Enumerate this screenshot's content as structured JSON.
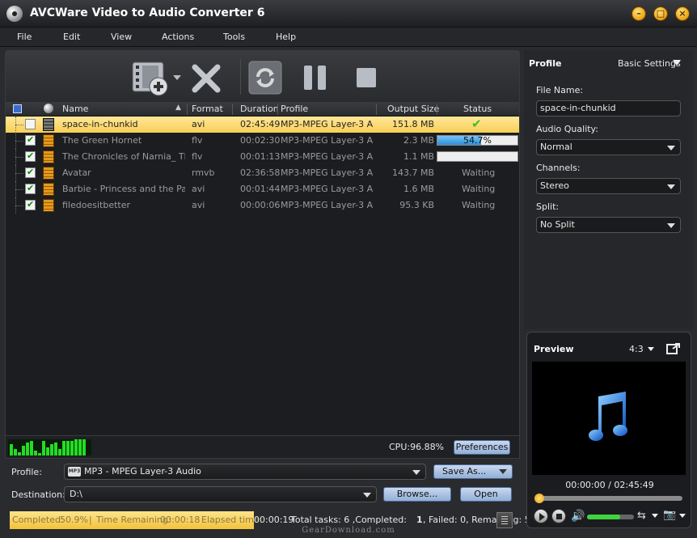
{
  "window": {
    "title": "AVCWare Video to Audio Converter 6",
    "minimize": "–",
    "maximize": "□",
    "close": "×"
  },
  "menu": [
    "File",
    "Edit",
    "View",
    "Actions",
    "Tools",
    "Help"
  ],
  "table": {
    "columns": [
      "Name",
      "Format",
      "Duration",
      "Profile",
      "Output Size",
      "Status"
    ],
    "rows": [
      {
        "name": "space-in-chunkid",
        "format": "avi",
        "duration": "02:45:49",
        "profile": "MP3-MPEG Layer-3 A...",
        "size": "151.8 MB",
        "status": "",
        "checked": false,
        "selected": true
      },
      {
        "name": "The Green Hornet",
        "format": "flv",
        "duration": "00:02:30",
        "profile": "MP3-MPEG Layer-3 A...",
        "size": "2.3 MB",
        "status": "54.7%",
        "progress": 54.7,
        "checked": true
      },
      {
        "name": "The Chronicles of Narnia_ The...",
        "format": "flv",
        "duration": "00:01:13",
        "profile": "MP3-MPEG Layer-3 A...",
        "size": "1.1 MB",
        "status": "",
        "progress": 0,
        "checked": true
      },
      {
        "name": "Avatar",
        "format": "rmvb",
        "duration": "02:36:58",
        "profile": "MP3-MPEG Layer-3 A...",
        "size": "143.7 MB",
        "status": "Waiting",
        "checked": true
      },
      {
        "name": "Barbie - Princess and the Pau...",
        "format": "avi",
        "duration": "00:01:44",
        "profile": "MP3-MPEG Layer-3 A...",
        "size": "1.6 MB",
        "status": "Waiting",
        "checked": true
      },
      {
        "name": "filedoesitbetter",
        "format": "avi",
        "duration": "00:00:06",
        "profile": "MP3-MPEG Layer-3 A...",
        "size": "95.3 KB",
        "status": "Waiting",
        "checked": true
      }
    ]
  },
  "cpu": {
    "label": "CPU:96.88%"
  },
  "buttons": {
    "preferences": "Preferences",
    "save_as": "Save As...",
    "browse": "Browse...",
    "open": "Open"
  },
  "profile_bar": {
    "label": "Profile:",
    "value": "MP3 - MPEG Layer-3 Audio",
    "icon_text": "MP3"
  },
  "destination": {
    "label": "Destination:",
    "value": "D:\\"
  },
  "footer": {
    "completed_label": "Completed:",
    "completed_value": "50.9%",
    "sep": "|",
    "remaining_label": "Time Remaining:",
    "remaining_value": "00:00:18",
    "elapsed_label": "Elapsed time:",
    "elapsed_value": "00:00:19",
    "total": "Total tasks: 6 ,Completed: ",
    "completed_count": "1",
    "rest": ", Failed: 0, Remaining: 5"
  },
  "right_panel": {
    "title": "Profile",
    "settings_label": "Basic Settings",
    "file_name_label": "File Name:",
    "file_name_value": "space-in-chunkid",
    "audio_quality_label": "Audio Quality:",
    "audio_quality_value": "Normal",
    "channels_label": "Channels:",
    "channels_value": "Stereo",
    "split_label": "Split:",
    "split_value": "No Split"
  },
  "preview": {
    "title": "Preview",
    "aspect": "4:3",
    "time": "00:00:00 / 02:45:49",
    "volume": 0.7
  },
  "watermark": "GearDownload.com",
  "colors": {
    "accent": "#f8cf55",
    "progress": "#2b8fd8",
    "cpu": "#22dd22"
  }
}
